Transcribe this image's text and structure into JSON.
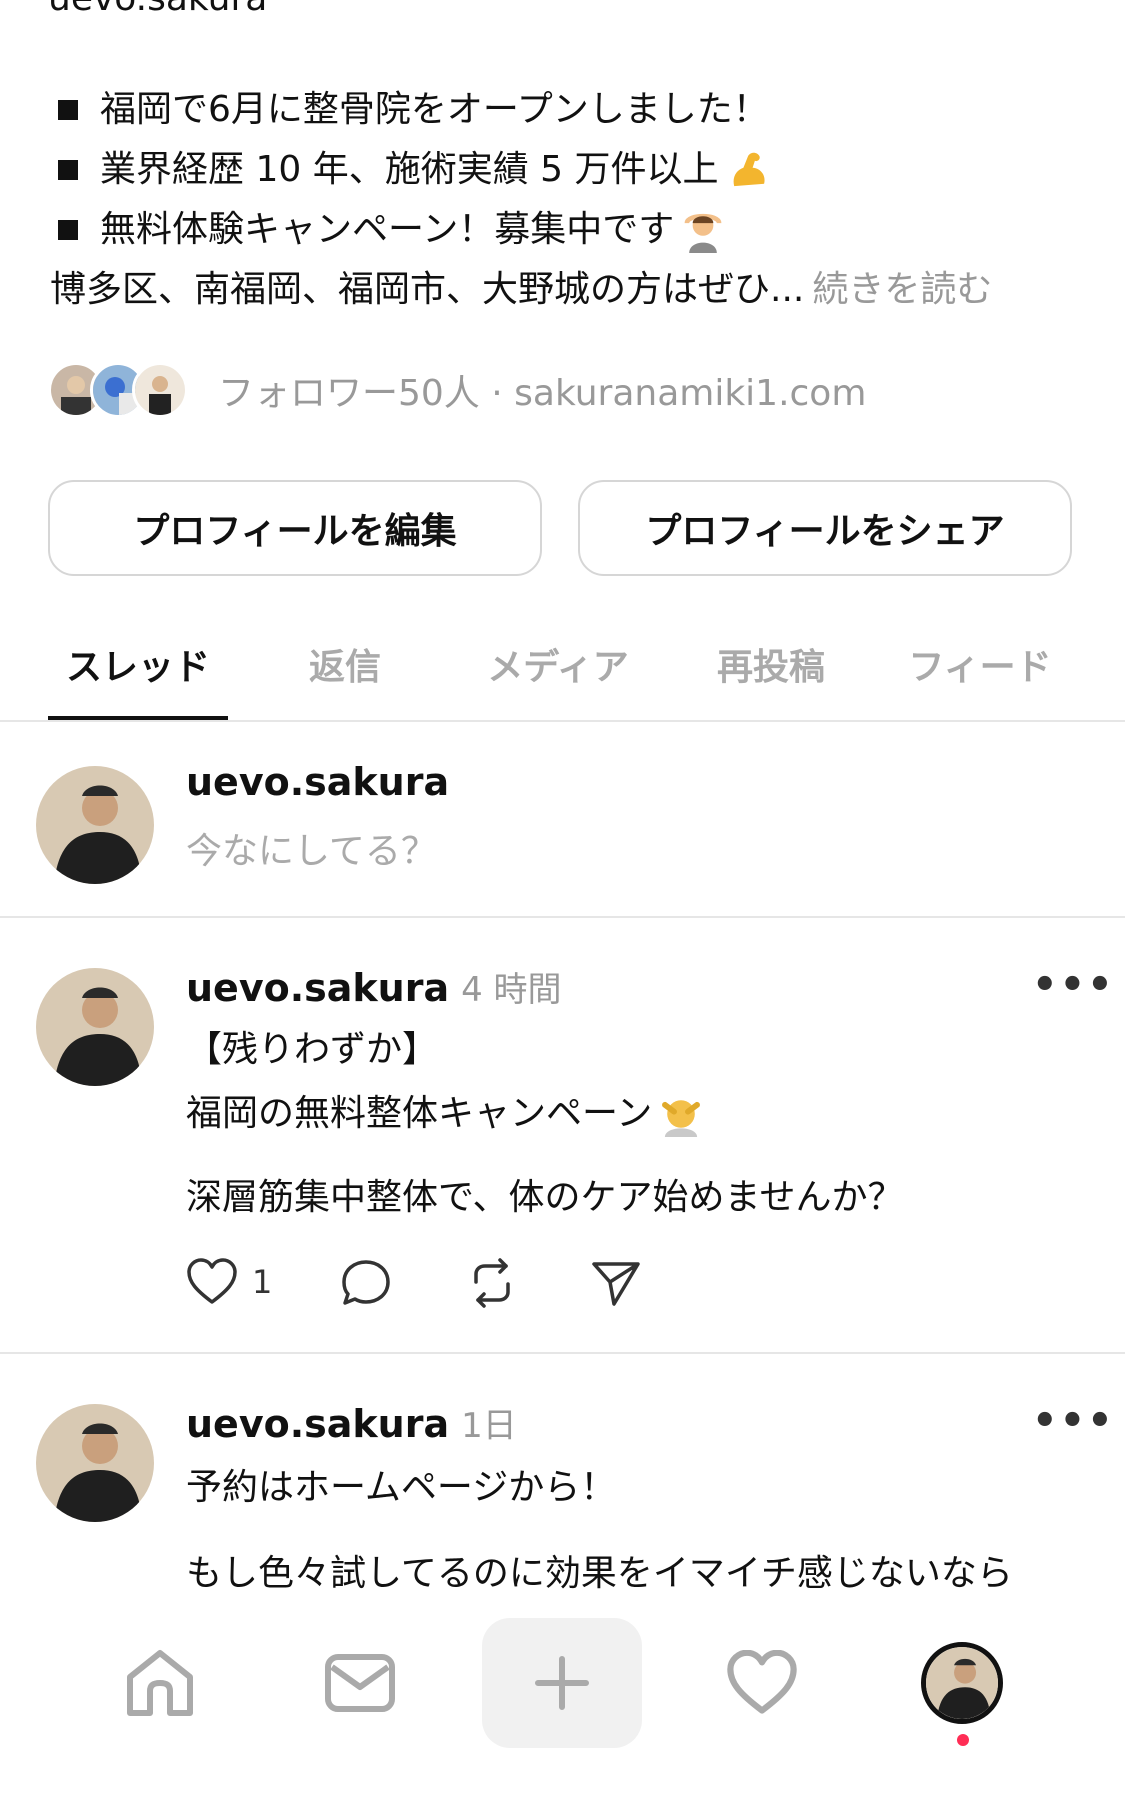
{
  "profile": {
    "username_top": "uevo.sakura",
    "bio_lines": [
      "福岡で6月に整骨院をオープンしました！",
      "業界経歴 10 年、施術実績 5 万件以上",
      "無料体験キャンペーン！募集中です"
    ],
    "bio_last": "博多区、南福岡、福岡市、大野城の方はぜひ...",
    "bio_more": "続きを読む",
    "followers_text": "フォロワー50人 · sakuranamiki1.com",
    "edit_button": "プロフィールを編集",
    "share_button": "プロフィールをシェア"
  },
  "tabs": [
    {
      "label": "スレッド"
    },
    {
      "label": "返信"
    },
    {
      "label": "メディア"
    },
    {
      "label": "再投稿"
    },
    {
      "label": "フィード"
    }
  ],
  "composer": {
    "username": "uevo.sakura",
    "placeholder": "今なにしてる？"
  },
  "posts": [
    {
      "username": "uevo.sakura",
      "time": "4 時間",
      "lines": [
        "【残りわずか】",
        "福岡の無料整体キャンペーン",
        "深層筋集中整体で、体のケア始めませんか？"
      ],
      "like_count": "1"
    },
    {
      "username": "uevo.sakura",
      "time": "1日",
      "lines": [
        "予約はホームページから！",
        "もし色々試してるのに効果をイマイチ感じないなら"
      ]
    }
  ],
  "icons": {
    "more": "more-horizontal-icon",
    "like": "heart-icon",
    "comment": "comment-icon",
    "repost": "repost-icon",
    "share": "send-icon",
    "nav": [
      "home-icon",
      "inbox-icon",
      "plus-icon",
      "heart-icon",
      "profile-avatar"
    ]
  },
  "colors": {
    "text": "#111111",
    "muted": "#999999",
    "divider": "#e6e6e6",
    "notification_dot": "#ff2d55"
  }
}
